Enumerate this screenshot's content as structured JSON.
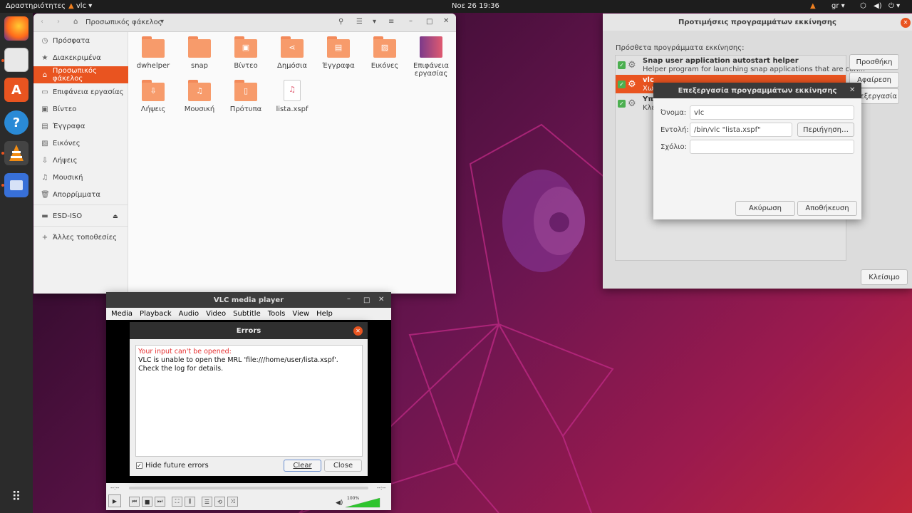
{
  "topbar": {
    "activities": "Δραστηριότητες",
    "app": "vlc",
    "datetime": "Νοε 26  19:36",
    "lang": "gr"
  },
  "dock": [
    {
      "name": "firefox"
    },
    {
      "name": "files"
    },
    {
      "name": "software"
    },
    {
      "name": "help"
    },
    {
      "name": "vlc"
    },
    {
      "name": "screenshot"
    }
  ],
  "files": {
    "path": "Προσωπικός φάκελος",
    "sidebar": [
      "Πρόσφατα",
      "Διακεκριμένα",
      "Προσωπικός φάκελος",
      "Επιφάνεια εργασίας",
      "Βίντεο",
      "Έγγραφα",
      "Εικόνες",
      "Λήψεις",
      "Μουσική",
      "Απορρίμματα",
      "ESD-ISO",
      "Άλλες τοποθεσίες"
    ],
    "items": [
      "dwhelper",
      "snap",
      "Βίντεο",
      "Δημόσια",
      "Έγγραφα",
      "Εικόνες",
      "Επιφάνεια εργασίας",
      "Λήψεις",
      "Μουσική",
      "Πρότυπα",
      "lista.xspf"
    ]
  },
  "startup": {
    "title": "Προτιμήσεις προγραμμάτων εκκίνησης",
    "label": "Πρόσθετα προγράμματα εκκίνησης:",
    "entries": [
      {
        "name": "Snap user application autostart helper",
        "desc": "Helper program for launching snap applications that are con..."
      },
      {
        "name": "vlc",
        "desc": "Χω"
      },
      {
        "name": "Υπ",
        "desc": "Κλε"
      }
    ],
    "add": "Προσθήκη",
    "remove": "Αφαίρεση",
    "edit": "Επεξεργασία",
    "close": "Κλείσιμο"
  },
  "edit_dialog": {
    "title": "Επεξεργασία προγραμμάτων εκκίνησης",
    "name_label": "Όνομα:",
    "name_value": "vlc",
    "command_label": "Εντολή:",
    "command_value": "/bin/vlc \"lista.xspf\"",
    "browse": "Περιήγηση…",
    "comment_label": "Σχόλιο:",
    "comment_value": "",
    "cancel": "Ακύρωση",
    "save": "Αποθήκευση"
  },
  "vlc": {
    "title": "VLC media player",
    "menu": [
      "Media",
      "Playback",
      "Audio",
      "Video",
      "Subtitle",
      "Tools",
      "View",
      "Help"
    ],
    "time_left": "--:--",
    "time_right": "--:--",
    "volume": "100%",
    "volume_level": 1.0
  },
  "errors": {
    "title": "Errors",
    "heading": "Your input can't be opened:",
    "message": "VLC is unable to open the MRL 'file:///home/user/lista.xspf'. Check the log for details.",
    "hide_label": "Hide future errors",
    "clear": "Clear",
    "close": "Close"
  },
  "colors": {
    "accent": "#e95420",
    "error_text": "#e53030"
  }
}
